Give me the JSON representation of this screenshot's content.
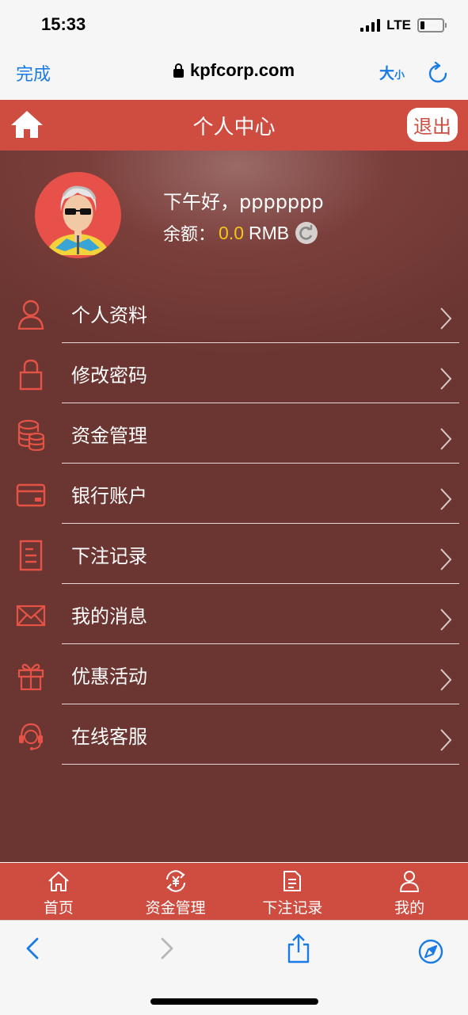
{
  "status_bar": {
    "time": "15:33",
    "network": "LTE"
  },
  "browser": {
    "done_label": "完成",
    "url": "kpfcorp.com",
    "text_size_big": "大",
    "text_size_small": "小"
  },
  "header": {
    "title": "个人中心",
    "logout_label": "退出"
  },
  "profile": {
    "greeting": "下午好，ppppppp",
    "balance_label": "余额：",
    "balance_amount": "0.0",
    "balance_unit": "RMB"
  },
  "menu": [
    {
      "label": "个人资料",
      "icon": "user-icon"
    },
    {
      "label": "修改密码",
      "icon": "lock-icon"
    },
    {
      "label": "资金管理",
      "icon": "coins-icon"
    },
    {
      "label": "银行账户",
      "icon": "card-icon"
    },
    {
      "label": "下注记录",
      "icon": "document-icon"
    },
    {
      "label": "我的消息",
      "icon": "envelope-icon"
    },
    {
      "label": "优惠活动",
      "icon": "gift-icon"
    },
    {
      "label": "在线客服",
      "icon": "headset-icon"
    }
  ],
  "tabs": [
    {
      "label": "首页",
      "icon": "home-icon"
    },
    {
      "label": "资金管理",
      "icon": "yuan-exchange-icon"
    },
    {
      "label": "下注记录",
      "icon": "document-icon"
    },
    {
      "label": "我的",
      "icon": "user-icon"
    }
  ],
  "colors": {
    "header": "#cf4c40",
    "background": "#6b3531",
    "accent_amount": "#f5c518",
    "link_blue": "#1a7be6"
  }
}
